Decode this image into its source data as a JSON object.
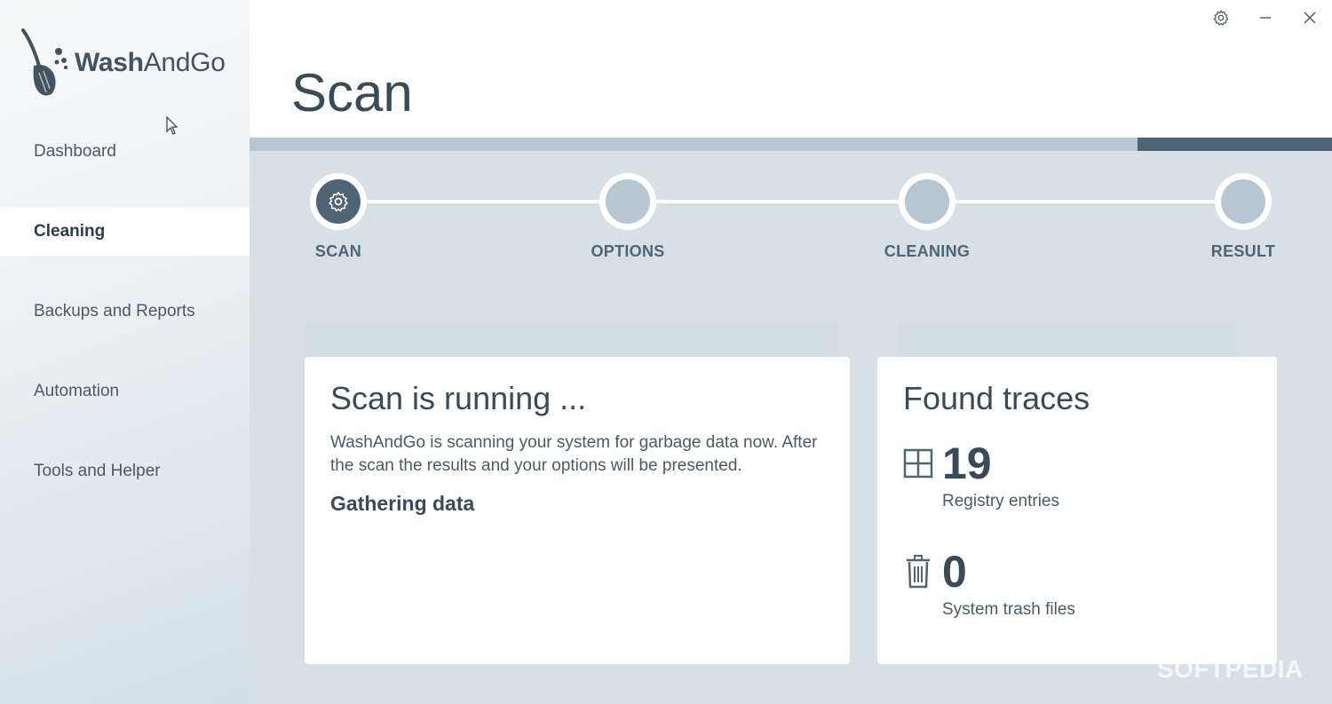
{
  "app": {
    "logo_bold": "Wash",
    "logo_regular": "AndGo"
  },
  "sidebar": {
    "items": [
      {
        "label": "Dashboard",
        "active": false
      },
      {
        "label": "Cleaning",
        "active": true
      },
      {
        "label": "Backups and Reports",
        "active": false
      },
      {
        "label": "Automation",
        "active": false
      },
      {
        "label": "Tools and Helper",
        "active": false
      }
    ]
  },
  "header": {
    "title": "Scan"
  },
  "steps": [
    {
      "label": "SCAN",
      "active": true
    },
    {
      "label": "OPTIONS",
      "active": false
    },
    {
      "label": "CLEANING",
      "active": false
    },
    {
      "label": "RESULT",
      "active": false
    }
  ],
  "scan_card": {
    "title": "Scan is running ...",
    "description": "WashAndGo is scanning your system for garbage data now. After the scan the results and your options will be presented.",
    "status": "Gathering data"
  },
  "traces_card": {
    "title": "Found traces",
    "items": [
      {
        "count": "19",
        "label": "Registry entries",
        "icon": "registry-grid-icon"
      },
      {
        "count": "0",
        "label": "System trash files",
        "icon": "trash-icon"
      }
    ]
  },
  "watermark": "SOFTPEDIA",
  "colors": {
    "accent": "#4f6474",
    "inactive_step": "#b8c6d1",
    "background": "#d8e0e6"
  }
}
